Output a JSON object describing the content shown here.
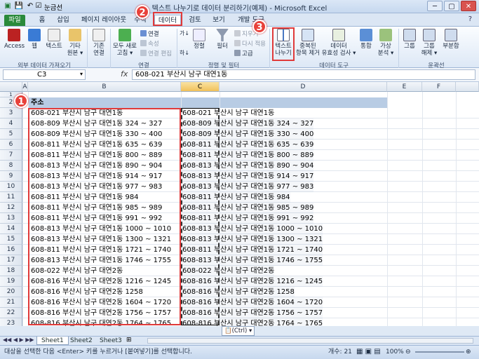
{
  "window": {
    "title": "텍스트 나누기로 데이터 분리하기(예제) - Microsoft Excel",
    "qa_label": "눈금선",
    "controls": [
      "─",
      "▢",
      "✕"
    ]
  },
  "tabs": [
    {
      "label": "파일"
    },
    {
      "label": "홈"
    },
    {
      "label": "삽입"
    },
    {
      "label": "페이지 레이아웃"
    },
    {
      "label": "수식"
    },
    {
      "label": "데이터"
    },
    {
      "label": "검토"
    },
    {
      "label": "보기"
    },
    {
      "label": "개발 도구"
    }
  ],
  "ribbon": {
    "access": "Access",
    "web": "웹",
    "text": "텍스트",
    "other_l1": "기타",
    "other_l2": "원본 ▾",
    "existing_l1": "기존",
    "existing_l2": "연결",
    "refresh_l1": "모두 새로",
    "refresh_l2": "고침 ▾",
    "conn": "연결",
    "props": "속성",
    "edit_links": "연결 편집",
    "sort_az": "정렬",
    "filter": "필터",
    "clear": "지우기",
    "reapply": "다시 적용",
    "advanced": "고급",
    "text_to_col_l1": "텍스트",
    "text_to_col_l2": "나누기",
    "remove_dup_l1": "중복된",
    "remove_dup_l2": "항목 제거",
    "validation_l1": "데이터",
    "validation_l2": "유효성 검사 ▾",
    "consolidate": "통합",
    "whatif_l1": "가상",
    "whatif_l2": "분석 ▾",
    "group": "그룹",
    "ungroup_l1": "그룹",
    "ungroup_l2": "해제 ▾",
    "subtotal": "부분합",
    "grp_external": "외부 데이터 가져오기",
    "grp_conn": "연결",
    "grp_sort": "정렬 및 필터",
    "grp_tools": "데이터 도구",
    "grp_outline": "윤곽선"
  },
  "formula_bar": {
    "name_box": "C3",
    "fx": "fx",
    "formula": "608-021 부산시 남구 대연1동"
  },
  "columns": [
    "A",
    "B",
    "C",
    "D",
    "E",
    "F"
  ],
  "header_row": {
    "num": "2",
    "label": "주소"
  },
  "rows": [
    {
      "num": "3",
      "val": "608-021 부산시 남구 대연1동"
    },
    {
      "num": "4",
      "val": "608-809 부산시 남구 대연1동 324 ~ 327"
    },
    {
      "num": "5",
      "val": "608-809 부산시 남구 대연1동 330 ~ 400"
    },
    {
      "num": "6",
      "val": "608-811 부산시 남구 대연1동 635 ~ 639"
    },
    {
      "num": "7",
      "val": "608-811 부산시 남구 대연1동 800 ~ 889"
    },
    {
      "num": "8",
      "val": "608-813 부산시 남구 대연1동 890 ~ 904"
    },
    {
      "num": "9",
      "val": "608-813 부산시 남구 대연1동 914 ~ 917"
    },
    {
      "num": "10",
      "val": "608-813 부산시 남구 대연1동 977 ~ 983"
    },
    {
      "num": "11",
      "val": "608-811 부산시 남구 대연1동 984"
    },
    {
      "num": "12",
      "val": "608-811 부산시 남구 대연1동 985 ~ 989"
    },
    {
      "num": "13",
      "val": "608-811 부산시 남구 대연1동 991 ~ 992"
    },
    {
      "num": "14",
      "val": "608-813 부산시 남구 대연1동 1000 ~ 1010"
    },
    {
      "num": "15",
      "val": "608-813 부산시 남구 대연1동 1300 ~ 1321"
    },
    {
      "num": "16",
      "val": "608-811 부산시 남구 대연1동 1721 ~ 1740"
    },
    {
      "num": "17",
      "val": "608-813 부산시 남구 대연1동 1746 ~ 1755"
    },
    {
      "num": "18",
      "val": "608-022 부산시 남구 대연2동"
    },
    {
      "num": "19",
      "val": "608-816 부산시 남구 대연2동 1216 ~ 1245"
    },
    {
      "num": "20",
      "val": "608-816 부산시 남구 대연2동 1258"
    },
    {
      "num": "21",
      "val": "608-816 부산시 남구 대연2동 1604 ~ 1720"
    },
    {
      "num": "22",
      "val": "608-816 부산시 남구 대연2동 1756 ~ 1757"
    },
    {
      "num": "23",
      "val": "608-816 부산시 남구 대연2동 1764 ~ 1765"
    }
  ],
  "ctrl_tag": "(Ctrl) ▾",
  "sheets": [
    {
      "label": "Sheet1"
    },
    {
      "label": "Sheet2"
    },
    {
      "label": "Sheet3"
    }
  ],
  "status": {
    "message": "대상을 선택한 다음 <Enter> 키를 누르거나 [붙여넣기]를 선택합니다.",
    "count": "개수: 21",
    "zoom": "100%"
  },
  "steps": [
    "1",
    "2",
    "3"
  ],
  "colors": {
    "accent_red": "#e03a3a",
    "file_tab": "#2a8a3b",
    "header_band": "#b8cce4"
  }
}
